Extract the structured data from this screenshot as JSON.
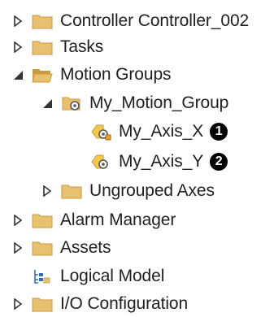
{
  "tree": {
    "items": [
      {
        "label": "Controller Controller_002",
        "icon": "folder-icon",
        "state": "collapsed"
      },
      {
        "label": "Tasks",
        "icon": "folder-icon",
        "state": "collapsed"
      },
      {
        "label": "Motion Groups",
        "icon": "open-folder-icon",
        "state": "expanded"
      },
      {
        "label": "My_Motion_Group",
        "icon": "motion-group-icon",
        "state": "expanded"
      },
      {
        "label": "My_Axis_X",
        "icon": "axis-warning-icon",
        "callout": "1"
      },
      {
        "label": "My_Axis_Y",
        "icon": "axis-icon",
        "callout": "2"
      },
      {
        "label": "Ungrouped Axes",
        "icon": "folder-icon",
        "state": "collapsed"
      },
      {
        "label": "Alarm Manager",
        "icon": "folder-icon",
        "state": "collapsed"
      },
      {
        "label": "Assets",
        "icon": "folder-icon",
        "state": "collapsed"
      },
      {
        "label": "Logical Model",
        "icon": "logical-model-icon"
      },
      {
        "label": "I/O Configuration",
        "icon": "folder-icon",
        "state": "collapsed"
      }
    ]
  },
  "colors": {
    "folder": "#e8c170",
    "folder_dark": "#c99a3f",
    "callout_bg": "#000000",
    "text": "#1f1f1f"
  }
}
